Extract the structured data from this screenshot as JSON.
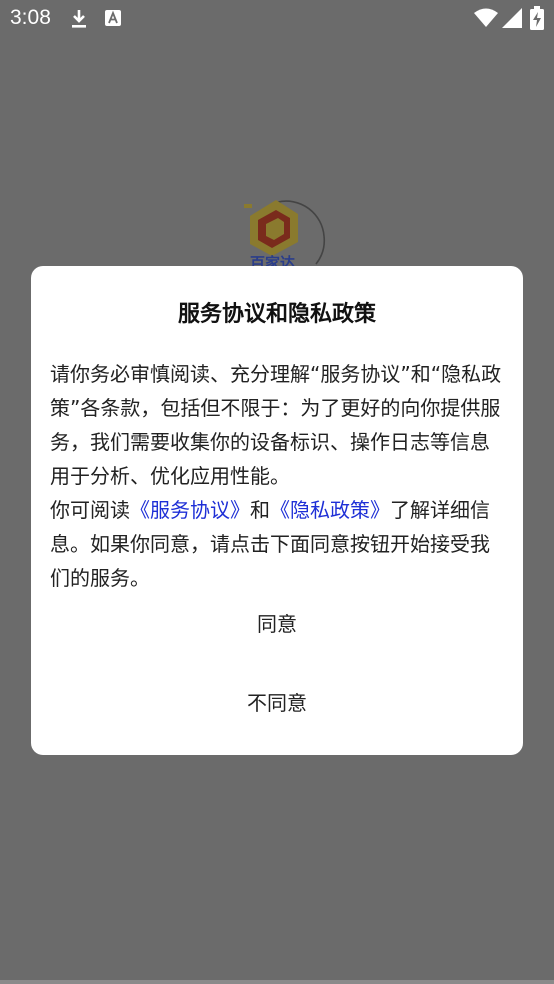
{
  "status_bar": {
    "time": "3:08",
    "icons": [
      "download-icon",
      "a-text-icon",
      "wifi-icon",
      "signal-icon",
      "battery-charging-icon"
    ]
  },
  "background": {
    "logo_text": "百家达"
  },
  "dialog": {
    "title": "服务协议和隐私政策",
    "body_part1": "请你务必审慎阅读、充分理解“服务协议”和“隐私政策”各条款，包括但不限于：为了更好的向你提供服务，我们需要收集你的设备标识、操作日志等信息用于分析、优化应用性能。",
    "body_part2_prefix": "你可阅读",
    "service_link": "《服务协议》",
    "conjunction": "和",
    "privacy_link": "《隐私政策》",
    "body_part2_suffix": "了解详细信息。如果你同意，请点击下面同意按钮开始接受我们的服务。",
    "agree_label": "同意",
    "disagree_label": "不同意"
  },
  "colors": {
    "overlay": "#6b6b6b",
    "dialog_bg": "#ffffff",
    "link": "#1e2fd6"
  }
}
